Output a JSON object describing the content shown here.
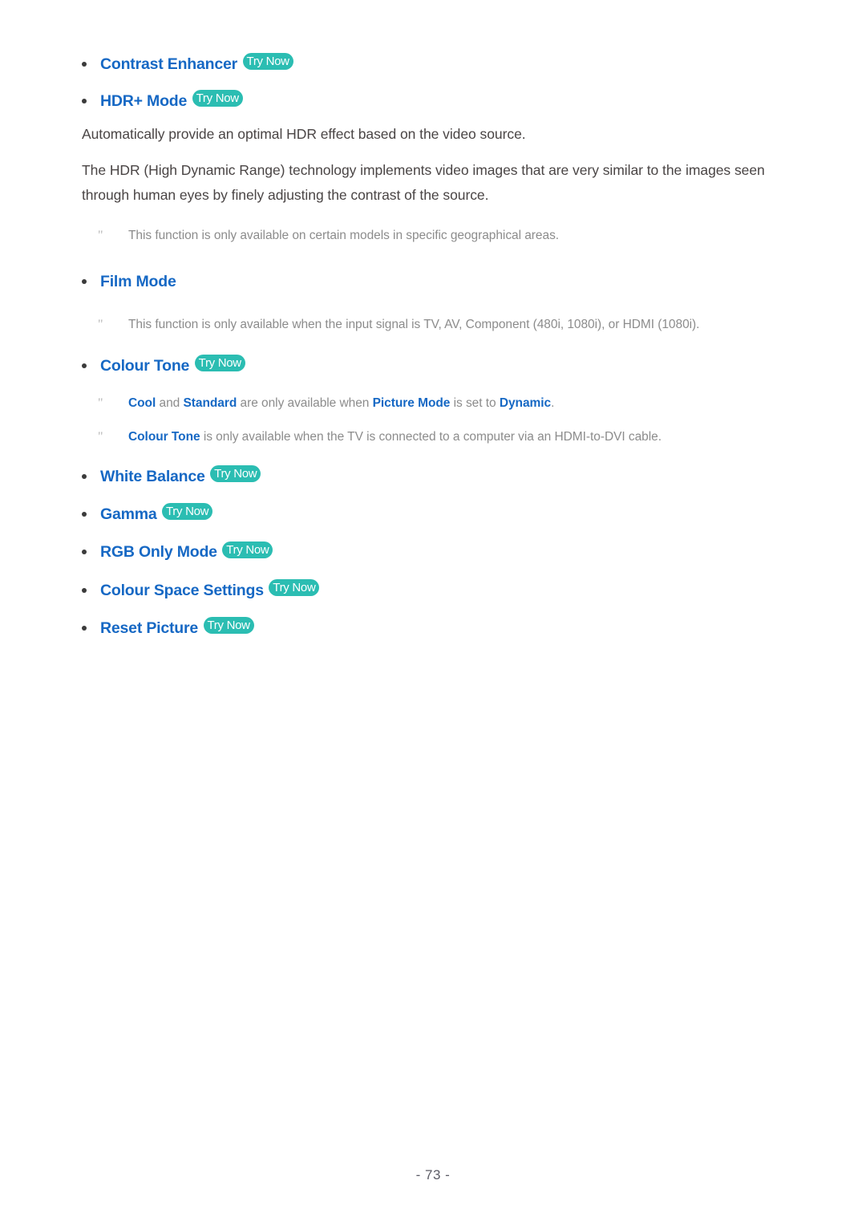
{
  "page": {
    "footer_label": "- 73 -",
    "background_color": "#ffffff",
    "link_color": "#1668c4",
    "badge_color": "#2bbdb2",
    "body_text_color": "#4a4545",
    "note_text_color": "#8c8c8c",
    "note_marker": "\""
  },
  "badges": {
    "try_now": "Try Now"
  },
  "bullets": {
    "contrast_enhancer": "Contrast Enhancer",
    "hdr_plus_mode": "HDR+ Mode",
    "film_mode": "Film Mode",
    "colour_tone": "Colour Tone",
    "white_balance": "White Balance",
    "gamma": "Gamma",
    "rgb_only_mode": "RGB Only Mode",
    "colour_space_settings": "Colour Space Settings",
    "reset_picture": "Reset Picture"
  },
  "paragraphs": {
    "hdr_intro": "Automatically provide an optimal HDR effect based on the video source.",
    "hdr_detail": "The HDR (High Dynamic Range) technology implements video images that are very similar to the images seen through human eyes by finely adjusting the contrast of the source."
  },
  "notes": {
    "hdr_availability": "This function is only available on certain models in specific geographical areas.",
    "film_mode_signal": "This function is only available when the input signal is TV, AV, Component (480i, 1080i), or HDMI (1080i).",
    "colour_tone_dynamic": {
      "kw_cool": "Cool",
      "mid_1": " and ",
      "kw_standard": "Standard",
      "mid_2": " are only available when ",
      "kw_picture_mode": "Picture Mode",
      "mid_3": " is set to ",
      "kw_dynamic": "Dynamic",
      "end": "."
    },
    "colour_tone_hdmi_dvi": {
      "kw_colour_tone": "Colour Tone",
      "rest": " is only available when the TV is connected to a computer via an HDMI-to-DVI cable."
    }
  }
}
